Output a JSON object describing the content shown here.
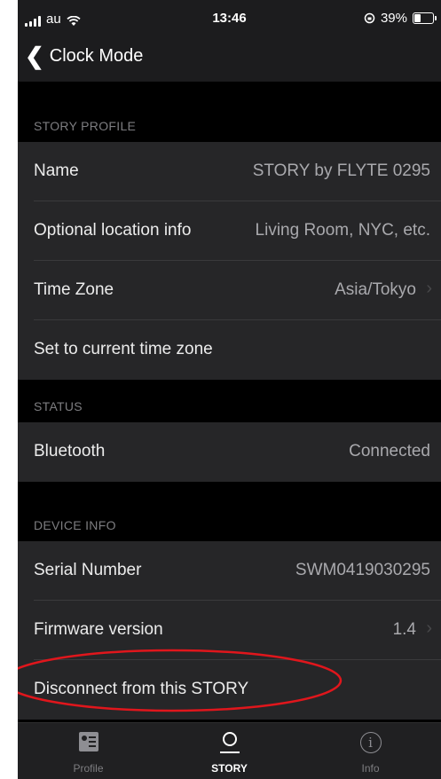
{
  "status_bar": {
    "carrier": "au",
    "time": "13:46",
    "battery": "39%",
    "battery_level": 0.39
  },
  "nav": {
    "back_title": "Clock Mode"
  },
  "sections": {
    "profile": {
      "header": "STORY PROFILE",
      "rows": [
        {
          "label": "Name",
          "value": "STORY by FLYTE 0295"
        },
        {
          "label": "Optional location info",
          "value": "Living Room, NYC, etc."
        },
        {
          "label": "Time Zone",
          "value": "Asia/Tokyo"
        },
        {
          "label": "Set to current time zone"
        }
      ]
    },
    "status": {
      "header": "STATUS",
      "rows": [
        {
          "label": "Bluetooth",
          "value": "Connected"
        }
      ]
    },
    "device_info": {
      "header": "DEVICE INFO",
      "rows": [
        {
          "label": "Serial Number",
          "value": "SWM0419030295"
        },
        {
          "label": "Firmware version",
          "value": "1.4"
        },
        {
          "label": "Disconnect from this STORY"
        }
      ]
    }
  },
  "tab_bar": {
    "tabs": [
      {
        "label": "Profile",
        "icon": "profile-card-icon"
      },
      {
        "label": "STORY",
        "icon": "story-clock-icon"
      },
      {
        "label": "Info",
        "icon": "info-circle-icon"
      }
    ],
    "active_index": 1
  },
  "colors": {
    "background": "#000000",
    "row": "#262628",
    "text": "#ececec",
    "muted": "#a9a9ad",
    "annotation": "#e0161c"
  }
}
